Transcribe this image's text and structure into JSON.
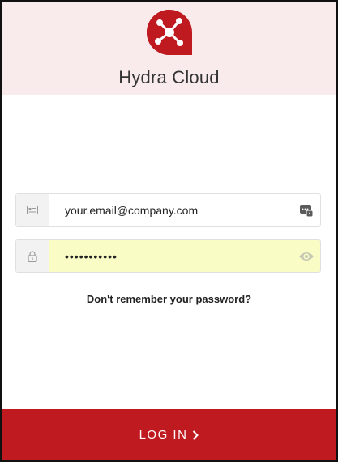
{
  "app": {
    "title": "Hydra Cloud",
    "logo": "hydra-logo"
  },
  "form": {
    "email": {
      "value": "your.email@company.com",
      "icon": "id-card-icon",
      "right_icon": "password-manager-icon"
    },
    "password": {
      "value": "•••••••••••",
      "icon": "lock-icon",
      "right_icon": "eye-icon"
    },
    "forgot_link": "Don't remember your password?",
    "login_button": "LOG IN"
  },
  "colors": {
    "brand": "#bf1a20",
    "header_bg": "#f9ebeb",
    "autofill_bg": "#fafcc6"
  }
}
